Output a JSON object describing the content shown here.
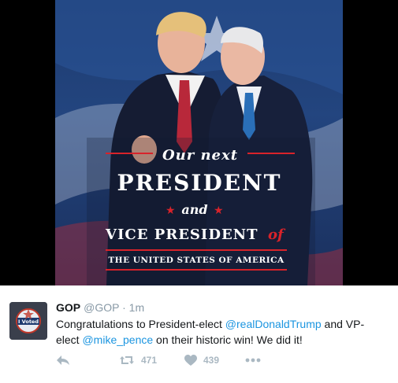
{
  "media": {
    "line1": "Our next",
    "line2": "PRESIDENT",
    "line3": "and",
    "line4_main": "VICE PRESIDENT",
    "line4_of": "of",
    "line5": "THE UNITED STATES OF AMERICA",
    "colors": {
      "red": "#d8232a",
      "white": "#ffffff",
      "navy": "#1d3a6e"
    }
  },
  "tweet": {
    "name": "GOP",
    "handle": "@GOP",
    "separator": "·",
    "time": "1m",
    "text_1": "Congratulations to President-elect ",
    "mention_1": "@realDonaldTrump",
    "text_2": " and VP-elect ",
    "mention_2": "@mike_pence",
    "text_3": " on their historic win! We did it!",
    "retweets": "471",
    "likes": "439",
    "avatar_badge": "I Voted"
  }
}
